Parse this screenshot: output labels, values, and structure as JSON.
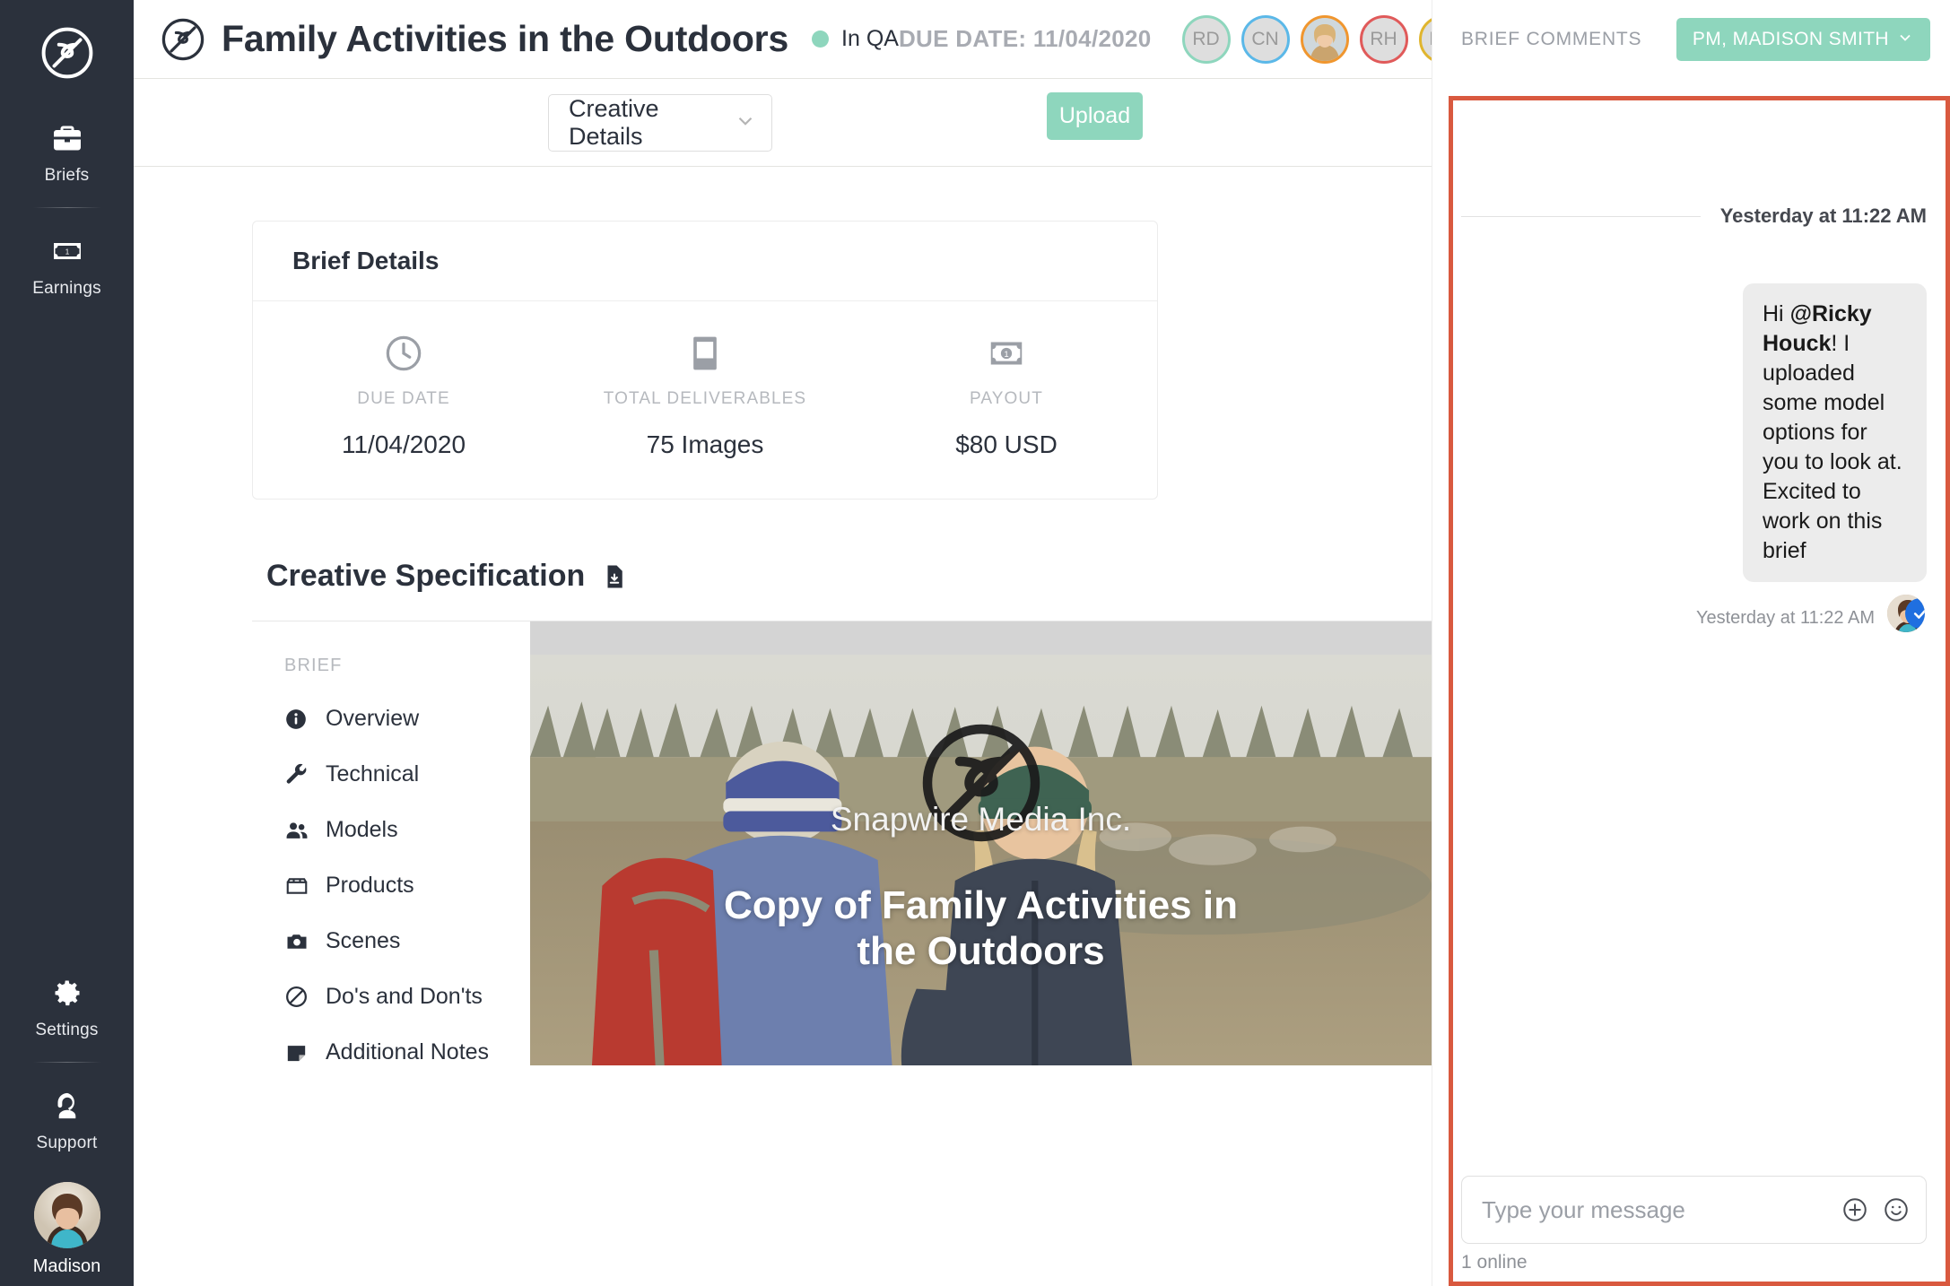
{
  "brand": {
    "logo_icon": "snapwire-s-logo",
    "accent_teal": "#8ed6bd",
    "accent_orange": "#d9593f",
    "rail_bg": "#2b313c"
  },
  "rail": {
    "items": [
      {
        "label": "Briefs",
        "icon": "briefcase-icon"
      },
      {
        "label": "Earnings",
        "icon": "banknote-icon"
      }
    ],
    "bottom_items": [
      {
        "label": "Settings",
        "icon": "gear-icon"
      },
      {
        "label": "Support",
        "icon": "headset-icon"
      }
    ],
    "user": {
      "name": "Madison",
      "avatar": "user-avatar"
    }
  },
  "header": {
    "title": "Family Activities in the Outdoors",
    "status": "In QA",
    "status_color": "#8ed6bd",
    "due_date": "DUE DATE: 11/04/2020",
    "avatars": [
      {
        "initials": "RD",
        "ring": "#8ed6bd",
        "photo": false
      },
      {
        "initials": "CN",
        "ring": "#5bb8e8",
        "photo": false
      },
      {
        "initials": "",
        "ring": "#f0962e",
        "photo": true
      },
      {
        "initials": "RH",
        "ring": "#e05a5a",
        "photo": false
      },
      {
        "initials": "RC",
        "ring": "#e0b52e",
        "photo": false
      }
    ]
  },
  "toolbar": {
    "view_select": "Creative Details",
    "view_select_caret": "chevron-down-icon",
    "upload_label": "Upload"
  },
  "brief_details": {
    "title": "Brief Details",
    "stats": [
      {
        "label": "DUE DATE",
        "value": "11/04/2020",
        "icon": "clock-icon"
      },
      {
        "label": "TOTAL DELIVERABLES",
        "value": "75 Images",
        "icon": "image-icon"
      },
      {
        "label": "PAYOUT",
        "value": "$80 USD",
        "icon": "banknote-icon"
      }
    ]
  },
  "creative_spec": {
    "title": "Creative Specification",
    "download_icon": "file-download-icon",
    "nav_heading": "BRIEF",
    "nav_items": [
      {
        "label": "Overview",
        "icon": "info-icon"
      },
      {
        "label": "Technical",
        "icon": "wrench-icon"
      },
      {
        "label": "Models",
        "icon": "people-icon"
      },
      {
        "label": "Products",
        "icon": "box-icon"
      },
      {
        "label": "Scenes",
        "icon": "camera-icon"
      },
      {
        "label": "Do's and Don'ts",
        "icon": "no-entry-icon"
      },
      {
        "label": "Additional Notes",
        "icon": "note-icon"
      }
    ],
    "hero": {
      "company": "Snapwire Media Inc.",
      "brief_name": "Copy of Family Activities in the Outdoors",
      "watermark_icon": "snapwire-s-logo"
    }
  },
  "comments": {
    "heading": "BRIEF COMMENTS",
    "pm_chip": "PM, MADISON SMITH",
    "pm_chip_caret": "chevron-down-icon",
    "day_separator": "Yesterday at 11:22 AM",
    "messages": [
      {
        "greeting": "Hi ",
        "mention": "@Ricky Houck",
        "body": "! I uploaded some model options for you to look at. Excited to work on this brief",
        "time": "Yesterday at 11:22 AM",
        "read_icon": "check-circle-icon"
      }
    ],
    "composer_placeholder": "Type your message",
    "composer_value": "",
    "add_icon": "plus-circle-icon",
    "emoji_icon": "smiley-icon",
    "online_status": "1 online"
  }
}
